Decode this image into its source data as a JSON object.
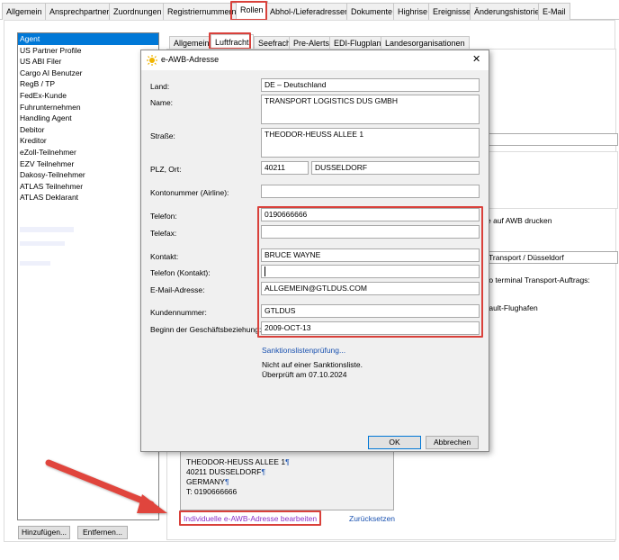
{
  "top_tabs": [
    "Allgemein",
    "Ansprechpartner",
    "Zuordnungen",
    "Registriernummern",
    "Rollen",
    "Abhol-/Lieferadressen",
    "Dokumente",
    "Highrise",
    "Ereignisse",
    "Änderungshistorie",
    "E-Mail"
  ],
  "sub_tabs": [
    "Allgemein",
    "Luftfracht",
    "Seefracht",
    "Pre-Alerts",
    "EDI-Flugplan",
    "Landesorganisationen"
  ],
  "roles": [
    "Agent",
    "US Partner Profile",
    "US ABI Filer",
    "Cargo AI Benutzer",
    "RegB / TP",
    "FedEx-Kunde",
    "Fuhrunternehmen",
    "Handling Agent",
    "Debitor",
    "Kreditor",
    "eZoll-Teilnehmer",
    "EZV Teilnehmer",
    "Dakosy-Teilnehmer",
    "ATLAS Teilnehmer",
    "ATLAS Deklarant"
  ],
  "buttons": {
    "add": "Hinzufügen...",
    "remove": "Entfernen..."
  },
  "right_panel": {
    "awb_print": "e auf AWB drucken",
    "transport": "Transport / Düsseldorf",
    "terminal": "to terminal Transport-Auftrags:",
    "airport": "fault-Flughafen"
  },
  "address_preview": {
    "line1": "THEODOR-HEUSS ALLEE 1",
    "line2": "40211 DUSSELDORF",
    "line3": "GERMANY",
    "line4": "T: 0190666666",
    "pilcrow": "¶"
  },
  "links": {
    "edit": "Individuelle e-AWB-Adresse bearbeiten",
    "reset": "Zurücksetzen"
  },
  "dialog": {
    "title": "e-AWB-Adresse",
    "close": "✕",
    "labels": {
      "land": "Land:",
      "name": "Name:",
      "strasse": "Straße:",
      "plz": "PLZ, Ort:",
      "konto": "Kontonummer (Airline):",
      "telefon": "Telefon:",
      "telefax": "Telefax:",
      "kontakt": "Kontakt:",
      "telefon_kontakt": "Telefon (Kontakt):",
      "email": "E-Mail-Adresse:",
      "kundennummer": "Kundennummer:",
      "beginn": "Beginn der Geschäftsbeziehung:"
    },
    "values": {
      "land": "DE – Deutschland",
      "name": "TRANSPORT LOGISTICS DUS GMBH",
      "strasse": "THEODOR-HEUSS ALLEE  1",
      "plz": "40211",
      "ort": "DUSSELDORF",
      "konto": "",
      "telefon": "0190666666",
      "telefax": "",
      "kontakt": "BRUCE WAYNE",
      "telefon_kontakt": "",
      "email": "ALLGEMEIN@GTLDUS.COM",
      "kundennummer": "GTLDUS",
      "beginn": "2009-OCT-13"
    },
    "sanction_link": "Sanktionslistenprüfung...",
    "sanction_status": "Nicht auf einer Sanktionsliste.",
    "sanction_checked": "Überprüft am 07.10.2024",
    "ok": "OK",
    "cancel": "Abbrechen"
  },
  "colors": {
    "highlight": "#d9413b",
    "selection": "#0078d7",
    "link": "#1a52b0",
    "edit_link": "#8b2fc9",
    "arrow": "#e0453c"
  }
}
